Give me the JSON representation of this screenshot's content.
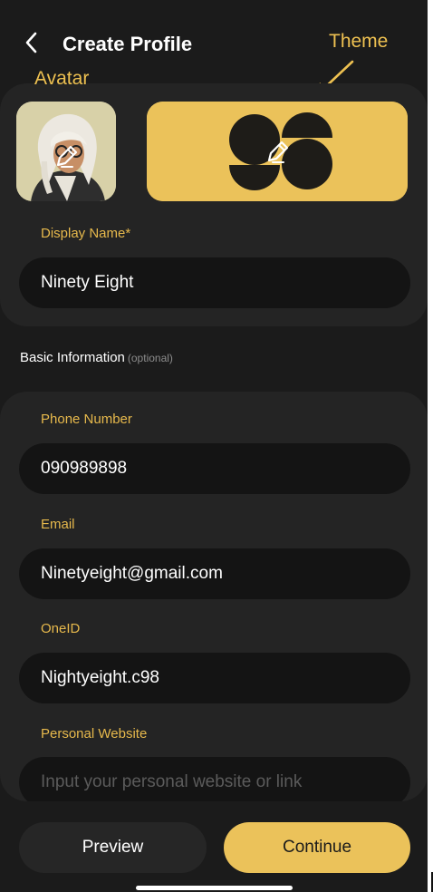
{
  "header": {
    "title": "Create Profile",
    "back_icon": "chevron-left-icon"
  },
  "annotations": {
    "avatar": "Avatar",
    "theme": "Theme"
  },
  "avatar": {
    "edit_icon": "pencil-icon"
  },
  "theme": {
    "logo": "98",
    "edit_icon": "pencil-icon",
    "color": "#ebc25a"
  },
  "display_name": {
    "label": "Display Name*",
    "value": "Ninety Eight"
  },
  "basic_info": {
    "heading": "Basic Information",
    "optional": "(optional)",
    "phone": {
      "label": "Phone Number",
      "value": "090989898"
    },
    "email": {
      "label": "Email",
      "value": "Ninetyeight@gmail.com"
    },
    "oneid": {
      "label": "OneID",
      "value": "Nightyeight.c98"
    },
    "website": {
      "label": "Personal Website",
      "value": "",
      "placeholder": "Input your personal website or link"
    }
  },
  "actions": {
    "preview": "Preview",
    "continue": "Continue"
  },
  "colors": {
    "background": "#1b1b1b",
    "accent": "#ebc25a",
    "label": "#e7b94c",
    "field": "#141414"
  }
}
